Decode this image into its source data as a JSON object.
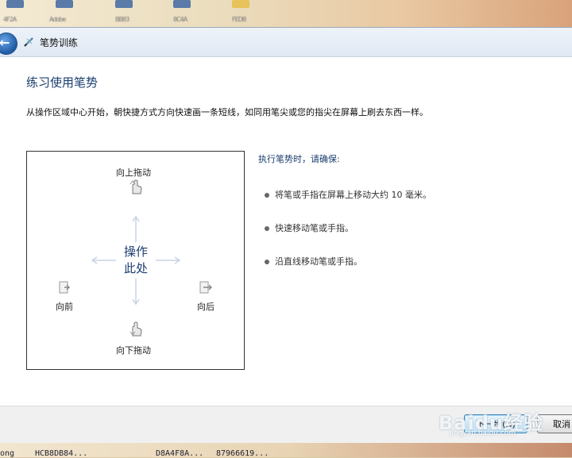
{
  "desktop": {
    "top_labels": [
      "4F2A",
      "Adobe",
      "BB83",
      "8C4A",
      "FEDB"
    ],
    "bottom_labels": [
      "ong",
      "HCB8DB84...",
      "D8A4F8A...",
      "87966619..."
    ]
  },
  "window": {
    "title": "笔势训练"
  },
  "main": {
    "heading": "练习使用笔势",
    "instruction": "从操作区域中心开始，朝快捷方式方向快速画一条短线，如同用笔尖或您的指尖在屏幕上刷去东西一样。",
    "panel": {
      "up_label": "向上拖动",
      "down_label": "向下拖动",
      "left_label": "向前",
      "right_label": "向后",
      "center_line1": "操作",
      "center_line2": "此处"
    },
    "tips": {
      "heading": "执行笔势时，请确保:",
      "items": [
        "将笔或手指在屏幕上移动大约 10 毫米。",
        "快速移动笔或手指。",
        "沿直线移动笔或手指。"
      ]
    }
  },
  "footer": {
    "next_label": "下一步(N)",
    "cancel_label": "取消",
    "watermark": "Baidu经验",
    "watermark_sub": "jingyan.baidu.com"
  },
  "colors": {
    "accent": "#1a3d6e",
    "arrow": "#c8d4e3"
  }
}
